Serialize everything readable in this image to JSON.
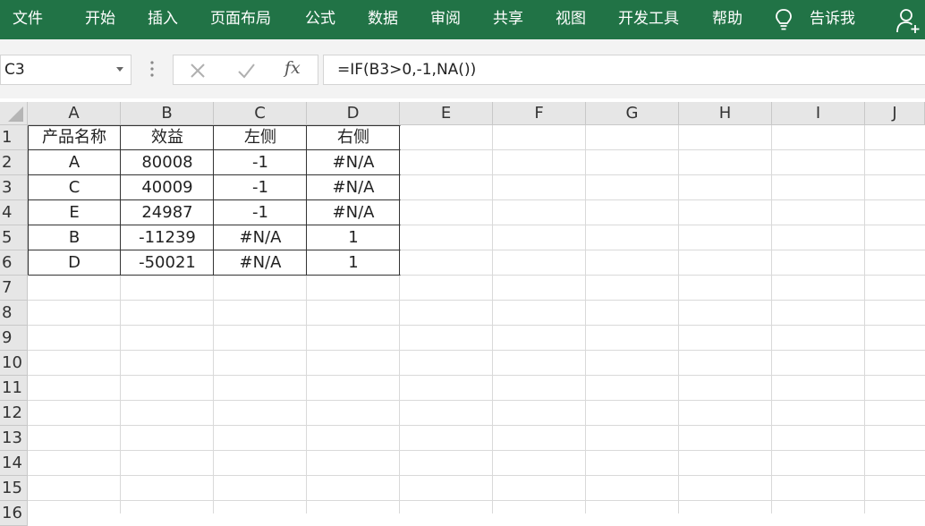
{
  "ribbon": {
    "tabs": [
      "文件",
      "开始",
      "插入",
      "页面布局",
      "公式",
      "数据",
      "审阅",
      "共享",
      "视图",
      "开发工具",
      "帮助"
    ],
    "tell_me": "告诉我",
    "bg_color": "#217346"
  },
  "name_box": {
    "value": "C3"
  },
  "formula_bar": {
    "value": "=IF(B3>0,-1,NA())",
    "fx_label": "fx"
  },
  "columns": [
    "A",
    "B",
    "C",
    "D",
    "E",
    "F",
    "G",
    "H",
    "I",
    "J"
  ],
  "rows": [
    "1",
    "2",
    "3",
    "4",
    "5",
    "6",
    "7",
    "8",
    "9",
    "10",
    "11",
    "12",
    "13",
    "14",
    "15",
    "16"
  ],
  "table": {
    "headers": [
      "产品名称",
      "效益",
      "左侧",
      "右侧"
    ],
    "rows": [
      [
        "A",
        "80008",
        "-1",
        "#N/A"
      ],
      [
        "C",
        "40009",
        "-1",
        "#N/A"
      ],
      [
        "E",
        "24987",
        "-1",
        "#N/A"
      ],
      [
        "B",
        "-11239",
        "#N/A",
        "1"
      ],
      [
        "D",
        "-50021",
        "#N/A",
        "1"
      ]
    ]
  }
}
